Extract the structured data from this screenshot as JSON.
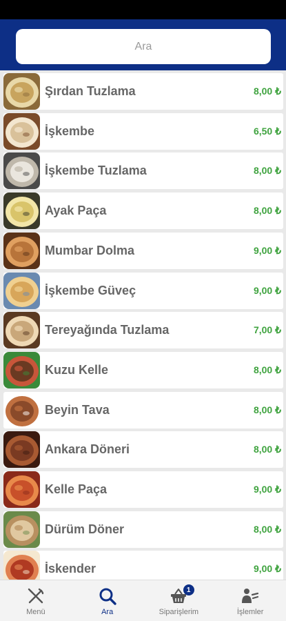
{
  "search": {
    "placeholder": "Ara",
    "value": ""
  },
  "menu": {
    "items": [
      {
        "name": "Şırdan Tuzlama",
        "price": "8,00 ₺",
        "colors": [
          "#c8a45e",
          "#e8d8a8",
          "#8a6a3a"
        ]
      },
      {
        "name": "İşkembe",
        "price": "6,50 ₺",
        "colors": [
          "#d9c19a",
          "#f3e6cf",
          "#7a4b2a"
        ]
      },
      {
        "name": "İşkembe Tuzlama",
        "price": "8,00 ₺",
        "colors": [
          "#eae6de",
          "#bfb8ab",
          "#4a4a4a"
        ]
      },
      {
        "name": "Ayak Paça",
        "price": "8,00 ₺",
        "colors": [
          "#d9c46a",
          "#f2e6a8",
          "#3a3a2a"
        ]
      },
      {
        "name": "Mumbar Dolma",
        "price": "9,00 ₺",
        "colors": [
          "#b8743a",
          "#e0a060",
          "#5a3218"
        ]
      },
      {
        "name": "İşkembe Güveç",
        "price": "9,00 ₺",
        "colors": [
          "#d8a65a",
          "#f0d090",
          "#6a8ab0"
        ]
      },
      {
        "name": "Tereyağında Tuzlama",
        "price": "7,00 ₺",
        "colors": [
          "#c9a77a",
          "#efd9b5",
          "#5a3a22"
        ]
      },
      {
        "name": "Kuzu Kelle",
        "price": "8,00 ₺",
        "colors": [
          "#6a3a22",
          "#c8563a",
          "#3a8a3a"
        ]
      },
      {
        "name": "Beyin Tava",
        "price": "8,00 ₺",
        "colors": [
          "#8a4a2a",
          "#c07040",
          "#ffffff"
        ]
      },
      {
        "name": "Ankara Döneri",
        "price": "8,00 ₺",
        "colors": [
          "#7a3a22",
          "#a85a32",
          "#3a1a10"
        ]
      },
      {
        "name": "Kelle Paça",
        "price": "9,00 ₺",
        "colors": [
          "#c8502a",
          "#e88a4a",
          "#8a2a1a"
        ]
      },
      {
        "name": "Dürüm Döner",
        "price": "8,00 ₺",
        "colors": [
          "#e0c8a0",
          "#b89060",
          "#6a8a4a"
        ]
      },
      {
        "name": "İskender",
        "price": "9,00 ₺",
        "colors": [
          "#b03a22",
          "#e08050",
          "#f5e8d0"
        ]
      }
    ]
  },
  "nav": {
    "items": [
      {
        "label": "Menü",
        "icon": "fork-knife-icon"
      },
      {
        "label": "Ara",
        "icon": "search-icon"
      },
      {
        "label": "Siparişlerim",
        "icon": "basket-icon",
        "badge": "1"
      },
      {
        "label": "İşlemler",
        "icon": "user-list-icon"
      }
    ]
  },
  "colors": {
    "header": "#0d2f86",
    "price": "#3fa33f",
    "active_nav": "#0d2f86"
  }
}
